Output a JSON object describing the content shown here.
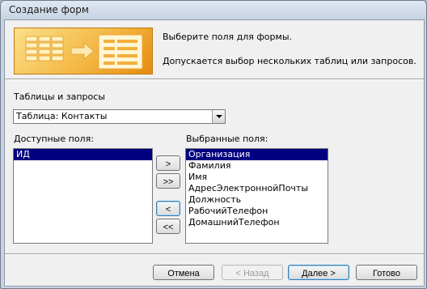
{
  "window": {
    "title": "Создание форм"
  },
  "header": {
    "line1": "Выберите поля для формы.",
    "line2": "Допускается выбор нескольких таблиц или запросов."
  },
  "source": {
    "label": "Таблицы и запросы",
    "selected": "Таблица: Контакты"
  },
  "available": {
    "label": "Доступные поля:",
    "items": [
      "ИД"
    ]
  },
  "selected_fields": {
    "label": "Выбранные поля:",
    "items": [
      "Организация",
      "Фамилия",
      "Имя",
      "АдресЭлектроннойПочты",
      "Должность",
      "РабочийТелефон",
      "ДомашнийТелефон"
    ]
  },
  "transfer": {
    "add_one": ">",
    "add_all": ">>",
    "remove_one": "<",
    "remove_all": "<<"
  },
  "footer": {
    "cancel": "Отмена",
    "back": "< Назад",
    "next": "Далее >",
    "finish": "Готово"
  },
  "colors": {
    "selection": "#000080",
    "banner": "#f4b845"
  }
}
